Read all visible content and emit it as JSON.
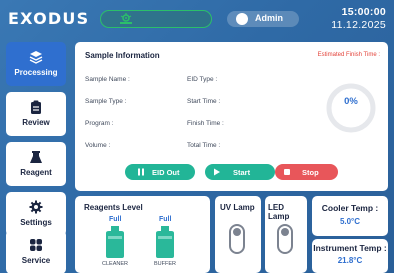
{
  "header": {
    "brand": "EXODUS",
    "user": "Admin",
    "time": "15:00:00",
    "date": "11.12.2025",
    "status_icon": "biohazard-icon",
    "status_color": "#2bbf6a"
  },
  "sidebar": {
    "items": [
      {
        "label": "Processing",
        "icon": "layers-icon",
        "active": true
      },
      {
        "label": "Review",
        "icon": "clipboard-icon",
        "active": false
      },
      {
        "label": "Reagent",
        "icon": "flask-icon",
        "active": false
      },
      {
        "label": "Settings",
        "icon": "gear-icon",
        "active": false
      },
      {
        "label": "Service",
        "icon": "grid-icon",
        "active": false
      }
    ]
  },
  "sample_info": {
    "title": "Sample Information",
    "finish_label": "Estimated Finish Time :",
    "left_fields": [
      "Sample Name :",
      "Sample Type :",
      "Program :",
      "Volume :"
    ],
    "right_fields": [
      "EID Type :",
      "Start Time :",
      "Finish Time :",
      "Total Time :"
    ],
    "progress": "0%",
    "progress_value": 0,
    "buttons": {
      "eid_out": "EID Out",
      "start": "Start",
      "stop": "Stop"
    }
  },
  "reagents": {
    "title": "Reagents Level",
    "items": [
      {
        "name": "CLEANER",
        "level": "Full"
      },
      {
        "name": "BUFFER",
        "level": "Full"
      }
    ]
  },
  "lamps": {
    "uv": "UV Lamp",
    "led": "LED Lamp"
  },
  "temps": {
    "cooler_title": "Cooler Temp :",
    "cooler_value": "5.0°C",
    "instrument_title": "Instrument Temp :",
    "instrument_value": "21.8°C"
  },
  "colors": {
    "accent": "#2f6fcf",
    "teal": "#22b597",
    "stop": "#e8565a",
    "warning": "#e3433a"
  }
}
